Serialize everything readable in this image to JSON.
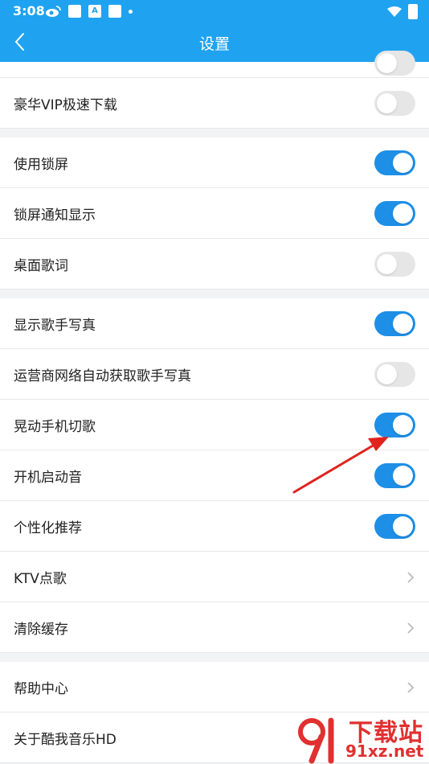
{
  "status_bar": {
    "time": "3:08",
    "notif_text": "A"
  },
  "header": {
    "title": "设置"
  },
  "rows": {
    "vip": {
      "label": "豪华VIP极速下载",
      "on": false
    },
    "lock_screen": {
      "label": "使用锁屏",
      "on": true
    },
    "lock_notify": {
      "label": "锁屏通知显示",
      "on": true
    },
    "desktop_lyrics": {
      "label": "桌面歌词",
      "on": false
    },
    "singer_photo": {
      "label": "显示歌手写真",
      "on": true
    },
    "carrier_photo": {
      "label": "运营商网络自动获取歌手写真",
      "on": false
    },
    "shake_switch": {
      "label": "晃动手机切歌",
      "on": true
    },
    "boot_sound": {
      "label": "开机启动音",
      "on": true
    },
    "personalized": {
      "label": "个性化推荐",
      "on": true
    },
    "ktv": {
      "label": "KTV点歌"
    },
    "clear_cache": {
      "label": "清除缓存"
    },
    "help": {
      "label": "帮助中心"
    },
    "about": {
      "label": "关于酷我音乐HD"
    }
  },
  "watermark": {
    "brand": "下载站",
    "url": "91xz.net"
  },
  "colors": {
    "accent": "#1fa3f0",
    "toggle_on": "#1e8fe6",
    "arrow": "#e0231f"
  }
}
